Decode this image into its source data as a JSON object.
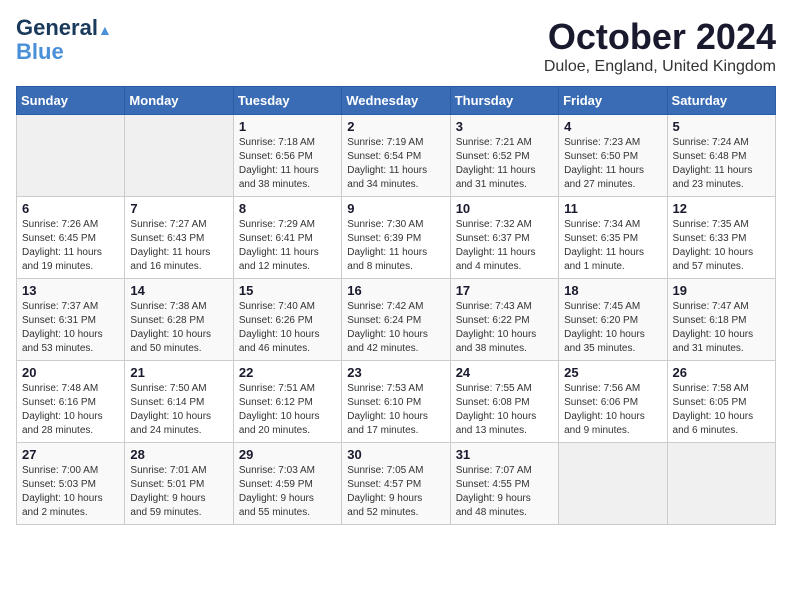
{
  "header": {
    "logo_line1": "General",
    "logo_line2": "Blue",
    "month": "October 2024",
    "location": "Duloe, England, United Kingdom"
  },
  "weekdays": [
    "Sunday",
    "Monday",
    "Tuesday",
    "Wednesday",
    "Thursday",
    "Friday",
    "Saturday"
  ],
  "weeks": [
    [
      {
        "day": "",
        "info": ""
      },
      {
        "day": "",
        "info": ""
      },
      {
        "day": "1",
        "info": "Sunrise: 7:18 AM\nSunset: 6:56 PM\nDaylight: 11 hours\nand 38 minutes."
      },
      {
        "day": "2",
        "info": "Sunrise: 7:19 AM\nSunset: 6:54 PM\nDaylight: 11 hours\nand 34 minutes."
      },
      {
        "day": "3",
        "info": "Sunrise: 7:21 AM\nSunset: 6:52 PM\nDaylight: 11 hours\nand 31 minutes."
      },
      {
        "day": "4",
        "info": "Sunrise: 7:23 AM\nSunset: 6:50 PM\nDaylight: 11 hours\nand 27 minutes."
      },
      {
        "day": "5",
        "info": "Sunrise: 7:24 AM\nSunset: 6:48 PM\nDaylight: 11 hours\nand 23 minutes."
      }
    ],
    [
      {
        "day": "6",
        "info": "Sunrise: 7:26 AM\nSunset: 6:45 PM\nDaylight: 11 hours\nand 19 minutes."
      },
      {
        "day": "7",
        "info": "Sunrise: 7:27 AM\nSunset: 6:43 PM\nDaylight: 11 hours\nand 16 minutes."
      },
      {
        "day": "8",
        "info": "Sunrise: 7:29 AM\nSunset: 6:41 PM\nDaylight: 11 hours\nand 12 minutes."
      },
      {
        "day": "9",
        "info": "Sunrise: 7:30 AM\nSunset: 6:39 PM\nDaylight: 11 hours\nand 8 minutes."
      },
      {
        "day": "10",
        "info": "Sunrise: 7:32 AM\nSunset: 6:37 PM\nDaylight: 11 hours\nand 4 minutes."
      },
      {
        "day": "11",
        "info": "Sunrise: 7:34 AM\nSunset: 6:35 PM\nDaylight: 11 hours\nand 1 minute."
      },
      {
        "day": "12",
        "info": "Sunrise: 7:35 AM\nSunset: 6:33 PM\nDaylight: 10 hours\nand 57 minutes."
      }
    ],
    [
      {
        "day": "13",
        "info": "Sunrise: 7:37 AM\nSunset: 6:31 PM\nDaylight: 10 hours\nand 53 minutes."
      },
      {
        "day": "14",
        "info": "Sunrise: 7:38 AM\nSunset: 6:28 PM\nDaylight: 10 hours\nand 50 minutes."
      },
      {
        "day": "15",
        "info": "Sunrise: 7:40 AM\nSunset: 6:26 PM\nDaylight: 10 hours\nand 46 minutes."
      },
      {
        "day": "16",
        "info": "Sunrise: 7:42 AM\nSunset: 6:24 PM\nDaylight: 10 hours\nand 42 minutes."
      },
      {
        "day": "17",
        "info": "Sunrise: 7:43 AM\nSunset: 6:22 PM\nDaylight: 10 hours\nand 38 minutes."
      },
      {
        "day": "18",
        "info": "Sunrise: 7:45 AM\nSunset: 6:20 PM\nDaylight: 10 hours\nand 35 minutes."
      },
      {
        "day": "19",
        "info": "Sunrise: 7:47 AM\nSunset: 6:18 PM\nDaylight: 10 hours\nand 31 minutes."
      }
    ],
    [
      {
        "day": "20",
        "info": "Sunrise: 7:48 AM\nSunset: 6:16 PM\nDaylight: 10 hours\nand 28 minutes."
      },
      {
        "day": "21",
        "info": "Sunrise: 7:50 AM\nSunset: 6:14 PM\nDaylight: 10 hours\nand 24 minutes."
      },
      {
        "day": "22",
        "info": "Sunrise: 7:51 AM\nSunset: 6:12 PM\nDaylight: 10 hours\nand 20 minutes."
      },
      {
        "day": "23",
        "info": "Sunrise: 7:53 AM\nSunset: 6:10 PM\nDaylight: 10 hours\nand 17 minutes."
      },
      {
        "day": "24",
        "info": "Sunrise: 7:55 AM\nSunset: 6:08 PM\nDaylight: 10 hours\nand 13 minutes."
      },
      {
        "day": "25",
        "info": "Sunrise: 7:56 AM\nSunset: 6:06 PM\nDaylight: 10 hours\nand 9 minutes."
      },
      {
        "day": "26",
        "info": "Sunrise: 7:58 AM\nSunset: 6:05 PM\nDaylight: 10 hours\nand 6 minutes."
      }
    ],
    [
      {
        "day": "27",
        "info": "Sunrise: 7:00 AM\nSunset: 5:03 PM\nDaylight: 10 hours\nand 2 minutes."
      },
      {
        "day": "28",
        "info": "Sunrise: 7:01 AM\nSunset: 5:01 PM\nDaylight: 9 hours\nand 59 minutes."
      },
      {
        "day": "29",
        "info": "Sunrise: 7:03 AM\nSunset: 4:59 PM\nDaylight: 9 hours\nand 55 minutes."
      },
      {
        "day": "30",
        "info": "Sunrise: 7:05 AM\nSunset: 4:57 PM\nDaylight: 9 hours\nand 52 minutes."
      },
      {
        "day": "31",
        "info": "Sunrise: 7:07 AM\nSunset: 4:55 PM\nDaylight: 9 hours\nand 48 minutes."
      },
      {
        "day": "",
        "info": ""
      },
      {
        "day": "",
        "info": ""
      }
    ]
  ]
}
